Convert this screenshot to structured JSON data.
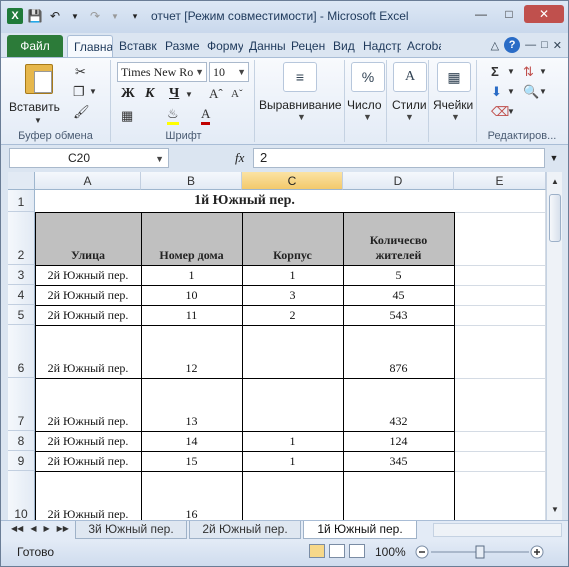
{
  "titlebar": {
    "title": "отчет  [Режим совместимости]  -  Microsoft Excel"
  },
  "tabs": [
    {
      "label": "Файл"
    },
    {
      "label": "Главна"
    },
    {
      "label": "Вставк"
    },
    {
      "label": "Разме"
    },
    {
      "label": "Форму"
    },
    {
      "label": "Данны"
    },
    {
      "label": "Рецен"
    },
    {
      "label": "Вид"
    },
    {
      "label": "Надстр"
    },
    {
      "label": "Acrobа"
    }
  ],
  "ribbon": {
    "paste_label": "Вставить",
    "font_name": "Times New Ro",
    "font_size": "10",
    "bold": "Ж",
    "italic": "К",
    "underline": "Ч",
    "align_label": "Выравнивание",
    "number_label": "Число",
    "styles_label": "Стили",
    "cells_label": "Ячейки",
    "groups": [
      "Буфер обмена",
      "Шрифт",
      "Редактиров..."
    ]
  },
  "formula_bar": {
    "name_box": "C20",
    "fx": "fx",
    "value": "2"
  },
  "grid": {
    "columns": [
      "A",
      "B",
      "C",
      "D",
      "E"
    ],
    "selected_column": "C",
    "rows": [
      "1",
      "2",
      "3",
      "4",
      "5",
      "6",
      "7",
      "8",
      "9",
      "10"
    ],
    "title": "1й Южный пер.",
    "headers": [
      "Улица",
      "Номер дома",
      "Корпус",
      "Количесво жителей"
    ],
    "data": [
      [
        "2й Южный пер.",
        "1",
        "1",
        "5"
      ],
      [
        "2й Южный пер.",
        "10",
        "3",
        "45"
      ],
      [
        "2й Южный пер.",
        "11",
        "2",
        "543"
      ],
      [
        "2й Южный пер.",
        "12",
        "",
        "876"
      ],
      [
        "2й Южный пер.",
        "13",
        "",
        "432"
      ],
      [
        "2й Южный пер.",
        "14",
        "1",
        "124"
      ],
      [
        "2й Южный пер.",
        "15",
        "1",
        "345"
      ],
      [
        "2й Южный пер.",
        "16",
        "",
        ""
      ]
    ]
  },
  "sheets": [
    {
      "label": "3й Южный пер."
    },
    {
      "label": "2й Южный пер."
    },
    {
      "label": "1й Южный пер.",
      "active": true
    }
  ],
  "status": {
    "ready": "Готово",
    "zoom": "100%"
  }
}
